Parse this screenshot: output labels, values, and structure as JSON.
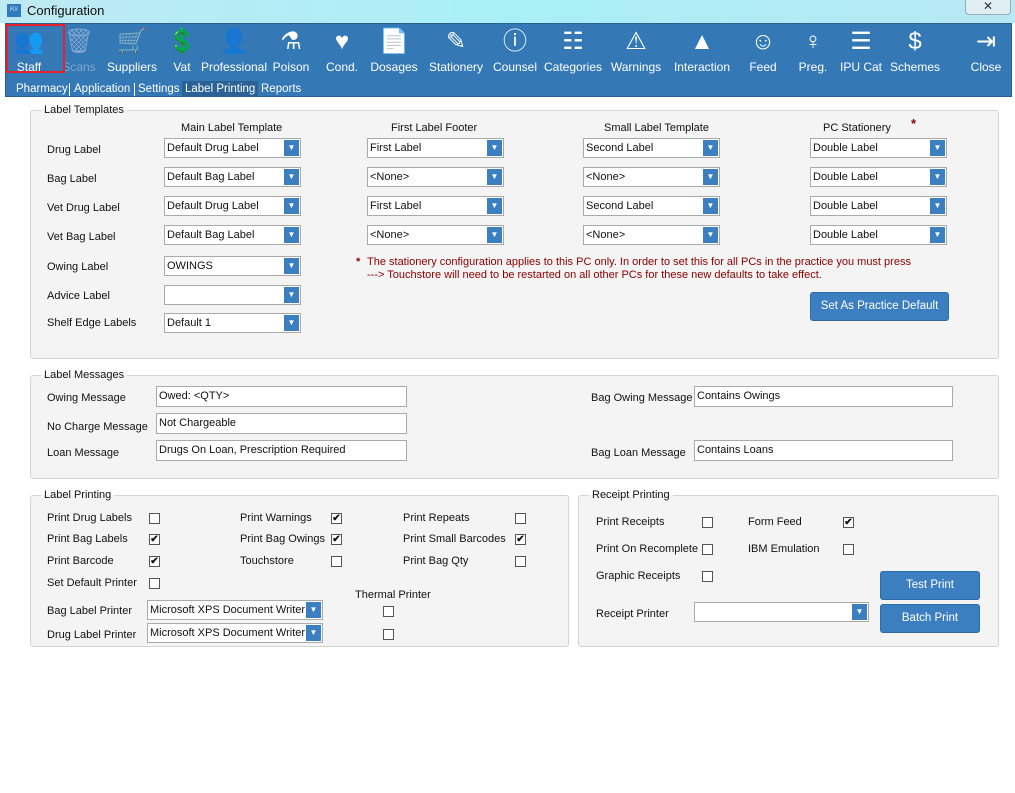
{
  "window": {
    "title": "Configuration",
    "app_icon": "RX",
    "close": "✕"
  },
  "toolbar": [
    {
      "label": "Staff",
      "icon": "staff-icon",
      "glyph": "👥",
      "enabled": true,
      "selected": true
    },
    {
      "label": "Scans",
      "icon": "scans-icon",
      "glyph": "🗑",
      "enabled": false
    },
    {
      "label": "Suppliers",
      "icon": "trolley-icon",
      "glyph": "🛒",
      "enabled": true
    },
    {
      "label": "Vat",
      "icon": "coins-icon",
      "glyph": "💲",
      "enabled": true
    },
    {
      "label": "Professional",
      "icon": "person-icon",
      "glyph": "👤",
      "enabled": true
    },
    {
      "label": "Poison",
      "icon": "flask-icon",
      "glyph": "⚗",
      "enabled": true
    },
    {
      "label": "Cond.",
      "icon": "heartbeat-icon",
      "glyph": "♥",
      "enabled": true
    },
    {
      "label": "Dosages",
      "icon": "document-icon",
      "glyph": "📄",
      "enabled": true
    },
    {
      "label": "Stationery",
      "icon": "pen-brush-icon",
      "glyph": "✎",
      "enabled": true
    },
    {
      "label": "Counsel",
      "icon": "info-icon",
      "glyph": "ⓘ",
      "enabled": true
    },
    {
      "label": "Categories",
      "icon": "hierarchy-icon",
      "glyph": "☷",
      "enabled": true
    },
    {
      "label": "Warnings",
      "icon": "warning-outline-icon",
      "glyph": "⚠",
      "enabled": true
    },
    {
      "label": "Interaction",
      "icon": "warning-filled-icon",
      "glyph": "▲",
      "enabled": true
    },
    {
      "label": "Feed",
      "icon": "breastfeed-icon",
      "glyph": "☺",
      "enabled": true
    },
    {
      "label": "Preg.",
      "icon": "pregnant-icon",
      "glyph": "♀",
      "enabled": true
    },
    {
      "label": "IPU Cat",
      "icon": "tree-icon",
      "glyph": "☰",
      "enabled": true
    },
    {
      "label": "Schemes",
      "icon": "dollar-circle-icon",
      "glyph": "$",
      "enabled": true
    },
    {
      "label": "Close",
      "icon": "exit-door-icon",
      "glyph": "⇥",
      "enabled": true
    }
  ],
  "subtabs": [
    {
      "label": "Pharmacy"
    },
    {
      "label": "Application"
    },
    {
      "label": "Settings"
    },
    {
      "label": "Label Printing",
      "selected": true
    },
    {
      "label": "Reports"
    }
  ],
  "templates": {
    "title": "Label Templates",
    "headers": [
      "Main Label Template",
      "First Label Footer",
      "Small Label Template",
      "PC Stationery"
    ],
    "asterisk": "*",
    "rows": [
      {
        "label": "Drug Label",
        "values": [
          "Default Drug Label",
          "First Label",
          "Second Label",
          "Double Label"
        ]
      },
      {
        "label": "Bag Label",
        "values": [
          "Default Bag Label",
          "<None>",
          "<None>",
          "Double Label"
        ]
      },
      {
        "label": "Vet Drug Label",
        "values": [
          "Default Drug Label",
          "First Label",
          "Second Label",
          "Double Label"
        ]
      },
      {
        "label": "Vet Bag Label",
        "values": [
          "Default Bag Label",
          "<None>",
          "<None>",
          "Double Label"
        ]
      }
    ],
    "owing": {
      "label": "Owing Label",
      "value": "OWINGS"
    },
    "advice": {
      "label": "Advice Label",
      "value": ""
    },
    "shelf": {
      "label": "Shelf Edge Labels",
      "value": "Default 1"
    },
    "note_star": "*",
    "note1": "The stationery configuration applies to this PC only. In order to set this for all PCs in the practice you must press",
    "note2": "---> Touchstore will need to be restarted on all other PCs for these new defaults to take effect.",
    "practice_default_button": "Set As Practice Default"
  },
  "messages": {
    "title": "Label Messages",
    "owing": {
      "label": "Owing Message",
      "value": "Owed: <QTY>"
    },
    "no_charge": {
      "label": "No Charge Message",
      "value": "Not Chargeable"
    },
    "loan": {
      "label": "Loan Message",
      "value": "Drugs On Loan, Prescription Required"
    },
    "bag_owing": {
      "label": "Bag Owing Message",
      "value": "Contains Owings"
    },
    "bag_loan": {
      "label": "Bag Loan Message",
      "value": "Contains Loans"
    }
  },
  "printing": {
    "title": "Label Printing",
    "checks": [
      {
        "label": "Print Drug Labels",
        "checked": false
      },
      {
        "label": "Print Bag Labels",
        "checked": true
      },
      {
        "label": "Print Barcode",
        "checked": true
      },
      {
        "label": "Set Default Printer",
        "checked": false
      },
      {
        "label": "Print Warnings",
        "checked": true
      },
      {
        "label": "Print Bag Owings",
        "checked": true
      },
      {
        "label": "Touchstore",
        "checked": false
      },
      {
        "label": "Print Repeats",
        "checked": false
      },
      {
        "label": "Print Small Barcodes",
        "checked": true
      },
      {
        "label": "Print Bag Qty",
        "checked": false
      }
    ],
    "thermal_label": "Thermal Printer",
    "thermal_bag": false,
    "thermal_drug": false,
    "bag_printer": {
      "label": "Bag Label Printer",
      "value": "Microsoft XPS Document Writer"
    },
    "drug_printer": {
      "label": "Drug Label Printer",
      "value": "Microsoft XPS Document Writer"
    }
  },
  "receipt": {
    "title": "Receipt Printing",
    "checks": [
      {
        "label": "Print Receipts",
        "checked": false
      },
      {
        "label": "Print On Recomplete",
        "checked": false
      },
      {
        "label": "Graphic Receipts",
        "checked": false
      },
      {
        "label": "Form Feed",
        "checked": true
      },
      {
        "label": "IBM Emulation",
        "checked": false
      }
    ],
    "printer": {
      "label": "Receipt Printer",
      "value": ""
    },
    "test_print": "Test Print",
    "batch_print": "Batch Print"
  },
  "colors": {
    "toolbar": "#3478b6",
    "accent": "#3c7fc1",
    "warning_text": "#8b0000",
    "highlight": "#e8202a"
  }
}
